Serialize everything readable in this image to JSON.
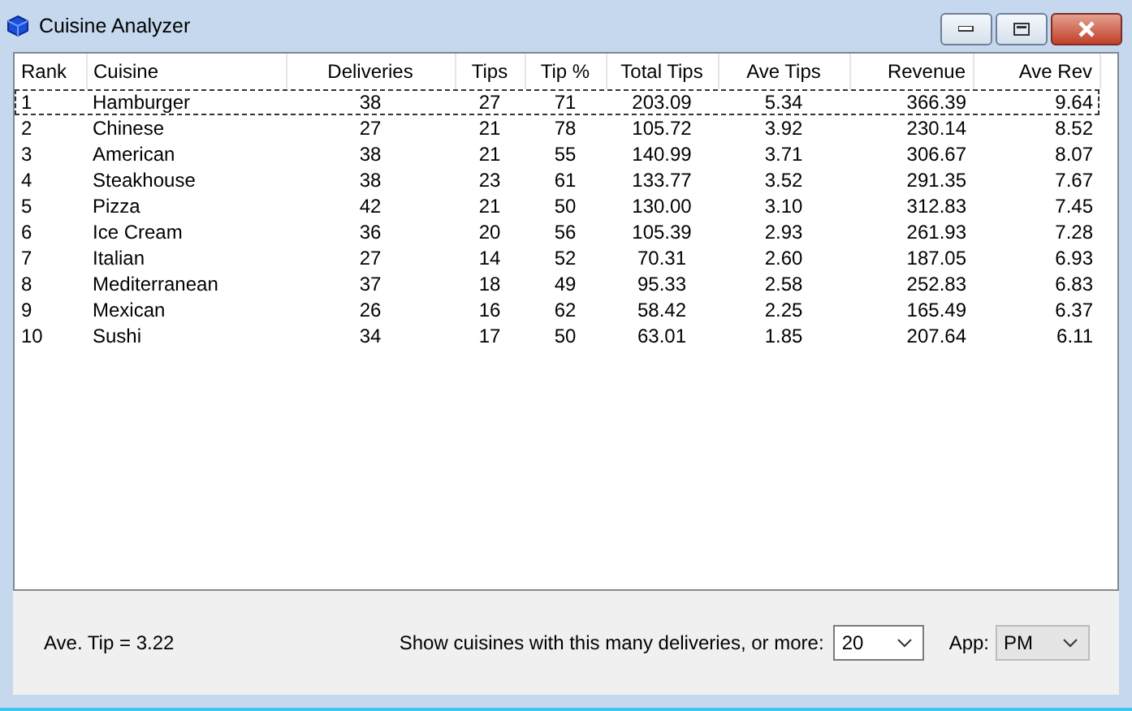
{
  "window": {
    "title": "Cuisine Analyzer"
  },
  "table": {
    "columns": [
      "Rank",
      "Cuisine",
      "Deliveries",
      "Tips",
      "Tip %",
      "Total Tips",
      "Ave Tips",
      "Revenue",
      "Ave Rev"
    ],
    "rows": [
      {
        "selected": true,
        "cells": [
          "1",
          "Hamburger",
          "38",
          "27",
          "71",
          "203.09",
          "5.34",
          "366.39",
          "9.64"
        ]
      },
      {
        "selected": false,
        "cells": [
          "2",
          "Chinese",
          "27",
          "21",
          "78",
          "105.72",
          "3.92",
          "230.14",
          "8.52"
        ]
      },
      {
        "selected": false,
        "cells": [
          "3",
          "American",
          "38",
          "21",
          "55",
          "140.99",
          "3.71",
          "306.67",
          "8.07"
        ]
      },
      {
        "selected": false,
        "cells": [
          "4",
          "Steakhouse",
          "38",
          "23",
          "61",
          "133.77",
          "3.52",
          "291.35",
          "7.67"
        ]
      },
      {
        "selected": false,
        "cells": [
          "5",
          "Pizza",
          "42",
          "21",
          "50",
          "130.00",
          "3.10",
          "312.83",
          "7.45"
        ]
      },
      {
        "selected": false,
        "cells": [
          "6",
          "Ice Cream",
          "36",
          "20",
          "56",
          "105.39",
          "2.93",
          "261.93",
          "7.28"
        ]
      },
      {
        "selected": false,
        "cells": [
          "7",
          "Italian",
          "27",
          "14",
          "52",
          "70.31",
          "2.60",
          "187.05",
          "6.93"
        ]
      },
      {
        "selected": false,
        "cells": [
          "8",
          "Mediterranean",
          "37",
          "18",
          "49",
          "95.33",
          "2.58",
          "252.83",
          "6.83"
        ]
      },
      {
        "selected": false,
        "cells": [
          "9",
          "Mexican",
          "26",
          "16",
          "62",
          "58.42",
          "2.25",
          "165.49",
          "6.37"
        ]
      },
      {
        "selected": false,
        "cells": [
          "10",
          "Sushi",
          "34",
          "17",
          "50",
          "63.01",
          "1.85",
          "207.64",
          "6.11"
        ]
      }
    ]
  },
  "footer": {
    "summary": "Ave. Tip = 3.22",
    "filter_label": "Show cuisines with this many deliveries, or more:",
    "filter_value": "20",
    "app_label": "App:",
    "app_value": "PM",
    "app_disabled": true
  }
}
